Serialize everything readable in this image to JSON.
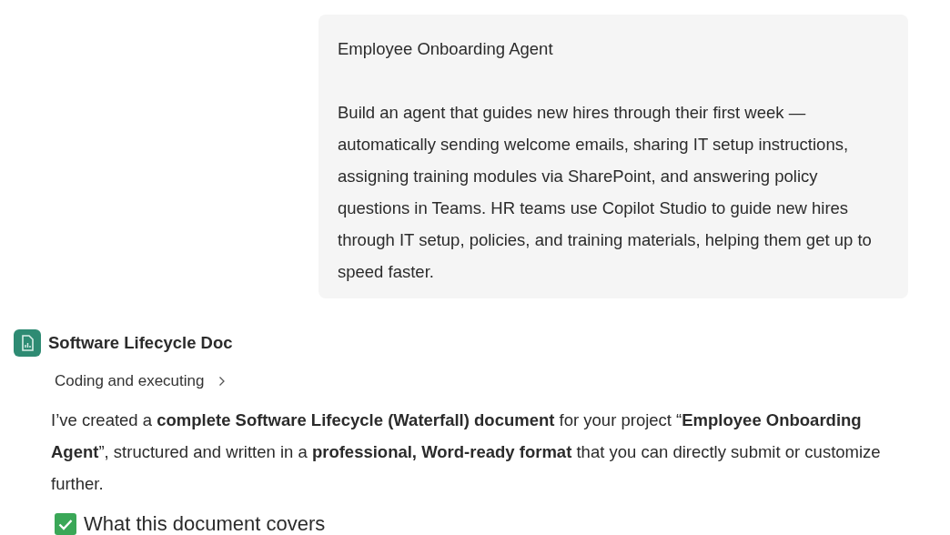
{
  "user_message": {
    "title": "Employee Onboarding Agent",
    "body": "Build an agent that guides new hires through their first week — automatically sending welcome emails, sharing IT setup instructions, assigning training modules via SharePoint, and answering policy questions in Teams. HR teams use Copilot Studio to guide new hires through IT setup, policies, and training materials, helping them get up to speed faster."
  },
  "response": {
    "agent_name": "Software Lifecycle Doc",
    "status": {
      "label": "Coding and executing",
      "expanded": false
    },
    "paragraph": "I’ve created a **complete Software Lifecycle (Waterfall) document** for your project “**Employee Onboarding Agent**”, structured and written in a **professional, Word-ready format** that you can directly submit or customize further.",
    "heading": "What this document covers"
  }
}
